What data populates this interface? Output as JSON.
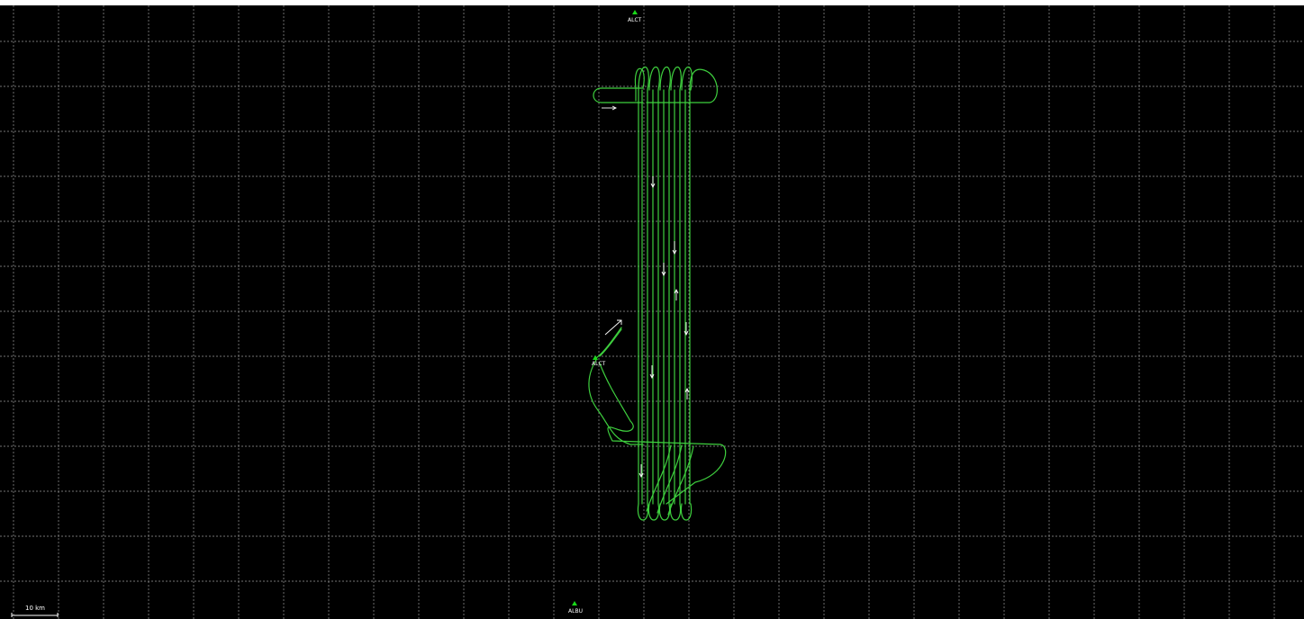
{
  "map": {
    "background": "#000000",
    "grid_color": "#9a9a9a",
    "track_color": "#3ecf3e",
    "station_color": "#19d919",
    "arrow_color": "#ffffff",
    "stations": [
      {
        "label": "ALCT",
        "name": "station-alct-top"
      },
      {
        "label": "ALCT",
        "name": "station-alct-mid"
      },
      {
        "label": "ALBU",
        "name": "station-albu"
      }
    ],
    "scale_bar": {
      "label": "10 km"
    }
  }
}
